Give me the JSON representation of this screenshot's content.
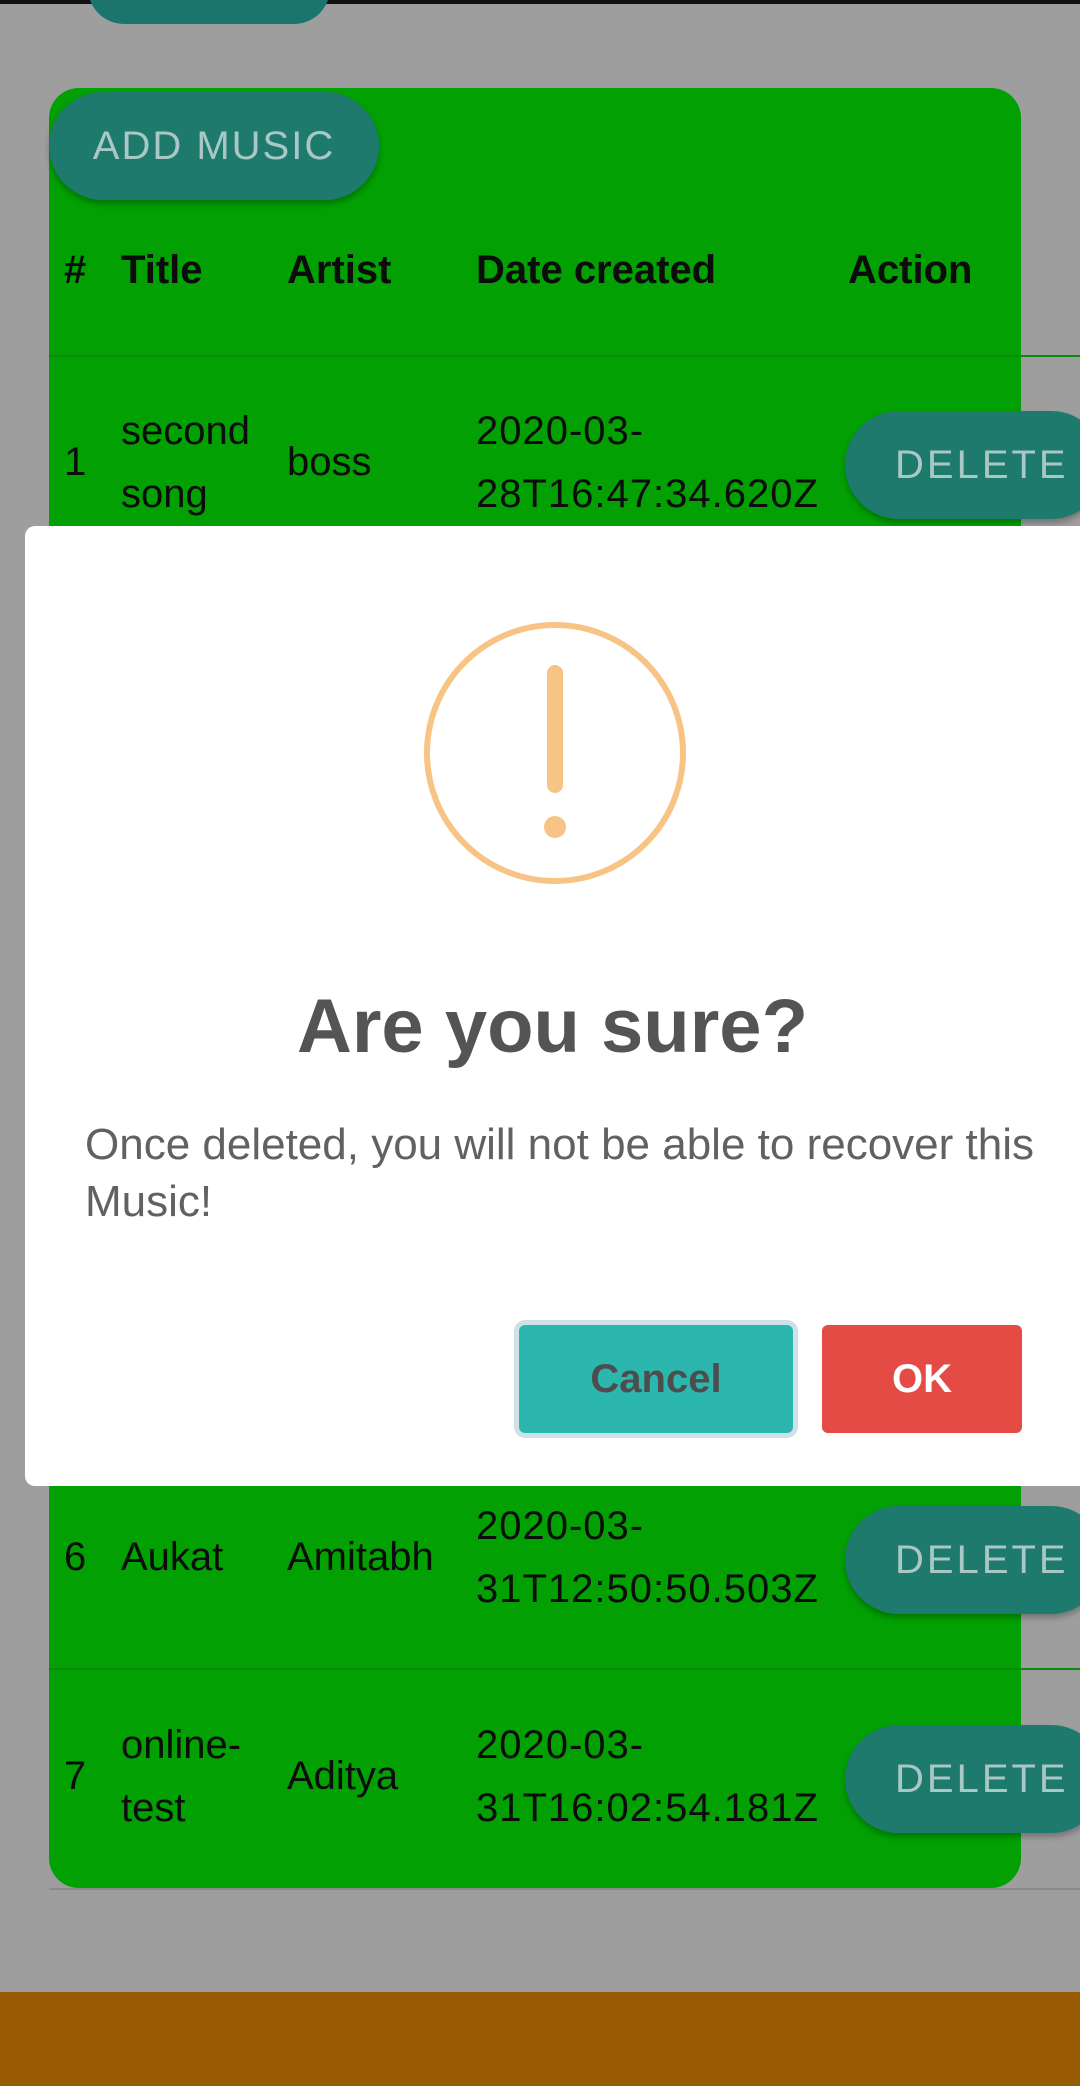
{
  "toolbar": {
    "add_label": "ADD MUSIC"
  },
  "table": {
    "headers": [
      "#",
      "Title",
      "Artist",
      "Date created",
      "Action"
    ],
    "rows": [
      {
        "num": "1",
        "title_l1": "second",
        "title_l2": "song",
        "artist": "boss",
        "date_l1": "2020-03-",
        "date_l2": "28T16:47:34.620Z",
        "action": "DELETE"
      },
      {
        "num": "6",
        "title_l1": "Aukat",
        "title_l2": "",
        "artist": "Amitabh",
        "date_l1": "2020-03-",
        "date_l2": "31T12:50:50.503Z",
        "action": "DELETE"
      },
      {
        "num": "7",
        "title_l1": "online-",
        "title_l2": "test",
        "artist": "Aditya",
        "date_l1": "2020-03-",
        "date_l2": "31T16:02:54.181Z",
        "action": "DELETE"
      }
    ]
  },
  "dialog": {
    "icon": "exclamation-circle-icon",
    "title": "Are you sure?",
    "text": "Once deleted, you will not be able to recover this Music!",
    "cancel_label": "Cancel",
    "ok_label": "OK"
  },
  "colors": {
    "card_green": "#02a002",
    "teal_button": "#1f7a6e",
    "warning_orange": "#f8c486",
    "cancel_teal": "#2bb7ad",
    "ok_red": "#e44b45",
    "footer": "#985b04"
  }
}
